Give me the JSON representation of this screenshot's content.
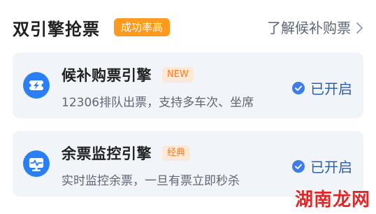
{
  "header": {
    "title": "双引擎抢票",
    "badge": "成功率高",
    "learn_link": "了解候补购票"
  },
  "cards": [
    {
      "title": "候补购票引擎",
      "badge": "NEW",
      "subtitle": "12306排队出票，支持多车次、坐席",
      "status": "已开启",
      "icon": "ticket-lightning-icon"
    },
    {
      "title": "余票监控引擎",
      "badge": "经典",
      "subtitle": "实时监控余票，一旦有票立即秒杀",
      "status": "已开启",
      "icon": "monitor-pulse-icon"
    }
  ],
  "watermark": "湖南龙网",
  "colors": {
    "accent_blue": "#2b7ff5",
    "header_badge_bg": "#ff9a1f",
    "card_badge_bg": "#fde9d7",
    "card_badge_text": "#ff7a1a",
    "status_text": "#2d5fa8",
    "card_bg": "#f1f5fa",
    "watermark": "#e21b1b"
  }
}
